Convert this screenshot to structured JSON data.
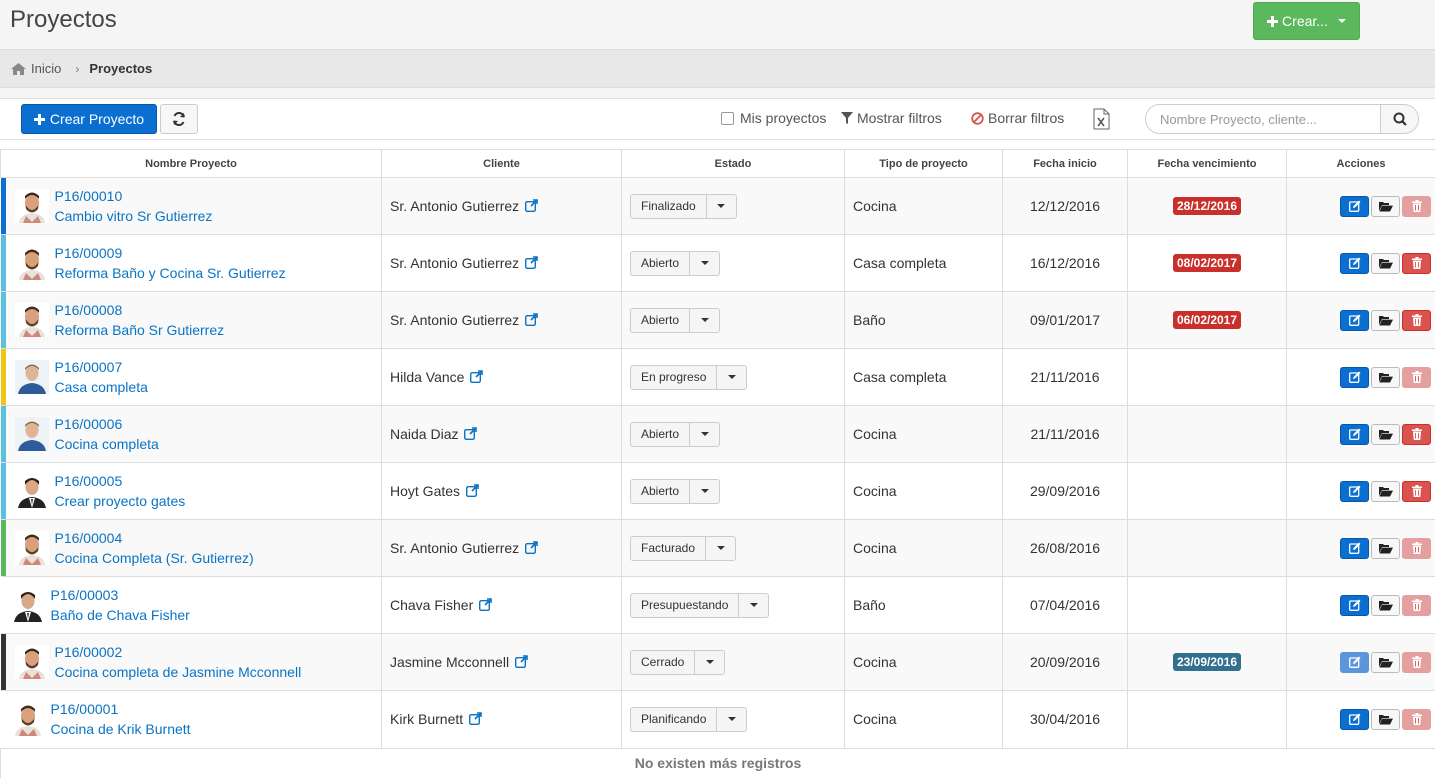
{
  "page": {
    "title": "Proyectos"
  },
  "top_button": {
    "label": "Crear..."
  },
  "breadcrumb": {
    "home": "Inicio",
    "current": "Proyectos"
  },
  "toolbar": {
    "create_label": "Crear Proyecto",
    "my_projects": "Mis proyectos",
    "show_filters": "Mostrar filtros",
    "clear_filters": "Borrar filtros",
    "search_placeholder": "Nombre Proyecto, cliente..."
  },
  "table": {
    "columns": [
      "Nombre Proyecto",
      "Cliente",
      "Estado",
      "Tipo de proyecto",
      "Fecha inicio",
      "Fecha vencimiento",
      "Acciones"
    ],
    "rows": [
      {
        "code": "P16/00010",
        "name": "Cambio vitro Sr Gutierrez",
        "client": "Sr. Antonio Gutierrez",
        "state": "Finalizado",
        "type": "Cocina",
        "start": "12/12/2016",
        "due": "28/12/2016",
        "due_color": "#c9302c",
        "accent": "#0a6fd1",
        "avatar": "beard",
        "edit_dim": false,
        "del_dim": true
      },
      {
        "code": "P16/00009",
        "name": "Reforma Baño y Cocina Sr. Gutierrez",
        "client": "Sr. Antonio Gutierrez",
        "state": "Abierto",
        "type": "Casa completa",
        "start": "16/12/2016",
        "due": "08/02/2017",
        "due_color": "#c9302c",
        "accent": "#5bc0de",
        "avatar": "beard",
        "edit_dim": false,
        "del_dim": false
      },
      {
        "code": "P16/00008",
        "name": "Reforma Baño Sr Gutierrez",
        "client": "Sr. Antonio Gutierrez",
        "state": "Abierto",
        "type": "Baño",
        "start": "09/01/2017",
        "due": "06/02/2017",
        "due_color": "#c9302c",
        "accent": "#5bc0de",
        "avatar": "beard",
        "edit_dim": false,
        "del_dim": false
      },
      {
        "code": "P16/00007",
        "name": "Casa completa",
        "client": "Hilda Vance",
        "state": "En progreso",
        "type": "Casa completa",
        "start": "21/11/2016",
        "due": "",
        "due_color": "",
        "accent": "#f0c419",
        "avatar": "blue",
        "edit_dim": false,
        "del_dim": true
      },
      {
        "code": "P16/00006",
        "name": "Cocina completa",
        "client": "Naida Diaz",
        "state": "Abierto",
        "type": "Cocina",
        "start": "21/11/2016",
        "due": "",
        "due_color": "",
        "accent": "#5bc0de",
        "avatar": "blue",
        "edit_dim": false,
        "del_dim": false
      },
      {
        "code": "P16/00005",
        "name": "Crear proyecto gates",
        "client": "Hoyt Gates",
        "state": "Abierto",
        "type": "Cocina",
        "start": "29/09/2016",
        "due": "",
        "due_color": "",
        "accent": "#5bc0de",
        "avatar": "suit",
        "edit_dim": false,
        "del_dim": false
      },
      {
        "code": "P16/00004",
        "name": "Cocina Completa (Sr. Gutierrez)",
        "client": "Sr. Antonio Gutierrez",
        "state": "Facturado",
        "type": "Cocina",
        "start": "26/08/2016",
        "due": "",
        "due_color": "",
        "accent": "#5cb85c",
        "avatar": "beard",
        "edit_dim": false,
        "del_dim": true
      },
      {
        "code": "P16/00003",
        "name": "Baño de Chava Fisher",
        "client": "Chava Fisher",
        "state": "Presupuestando",
        "type": "Baño",
        "start": "07/04/2016",
        "due": "",
        "due_color": "",
        "accent": "",
        "avatar": "suit",
        "edit_dim": false,
        "del_dim": true
      },
      {
        "code": "P16/00002",
        "name": "Cocina completa de Jasmine Mcconnell",
        "client": "Jasmine Mcconnell",
        "state": "Cerrado",
        "type": "Cocina",
        "start": "20/09/2016",
        "due": "23/09/2016",
        "due_color": "#31708f",
        "accent": "#333333",
        "avatar": "beard",
        "edit_dim": true,
        "del_dim": true
      },
      {
        "code": "P16/00001",
        "name": "Cocina de Krik Burnett",
        "client": "Kirk Burnett",
        "state": "Planificando",
        "type": "Cocina",
        "start": "30/04/2016",
        "due": "",
        "due_color": "",
        "accent": "",
        "avatar": "beard",
        "edit_dim": false,
        "del_dim": true
      }
    ],
    "footer": "No existen más registros"
  }
}
